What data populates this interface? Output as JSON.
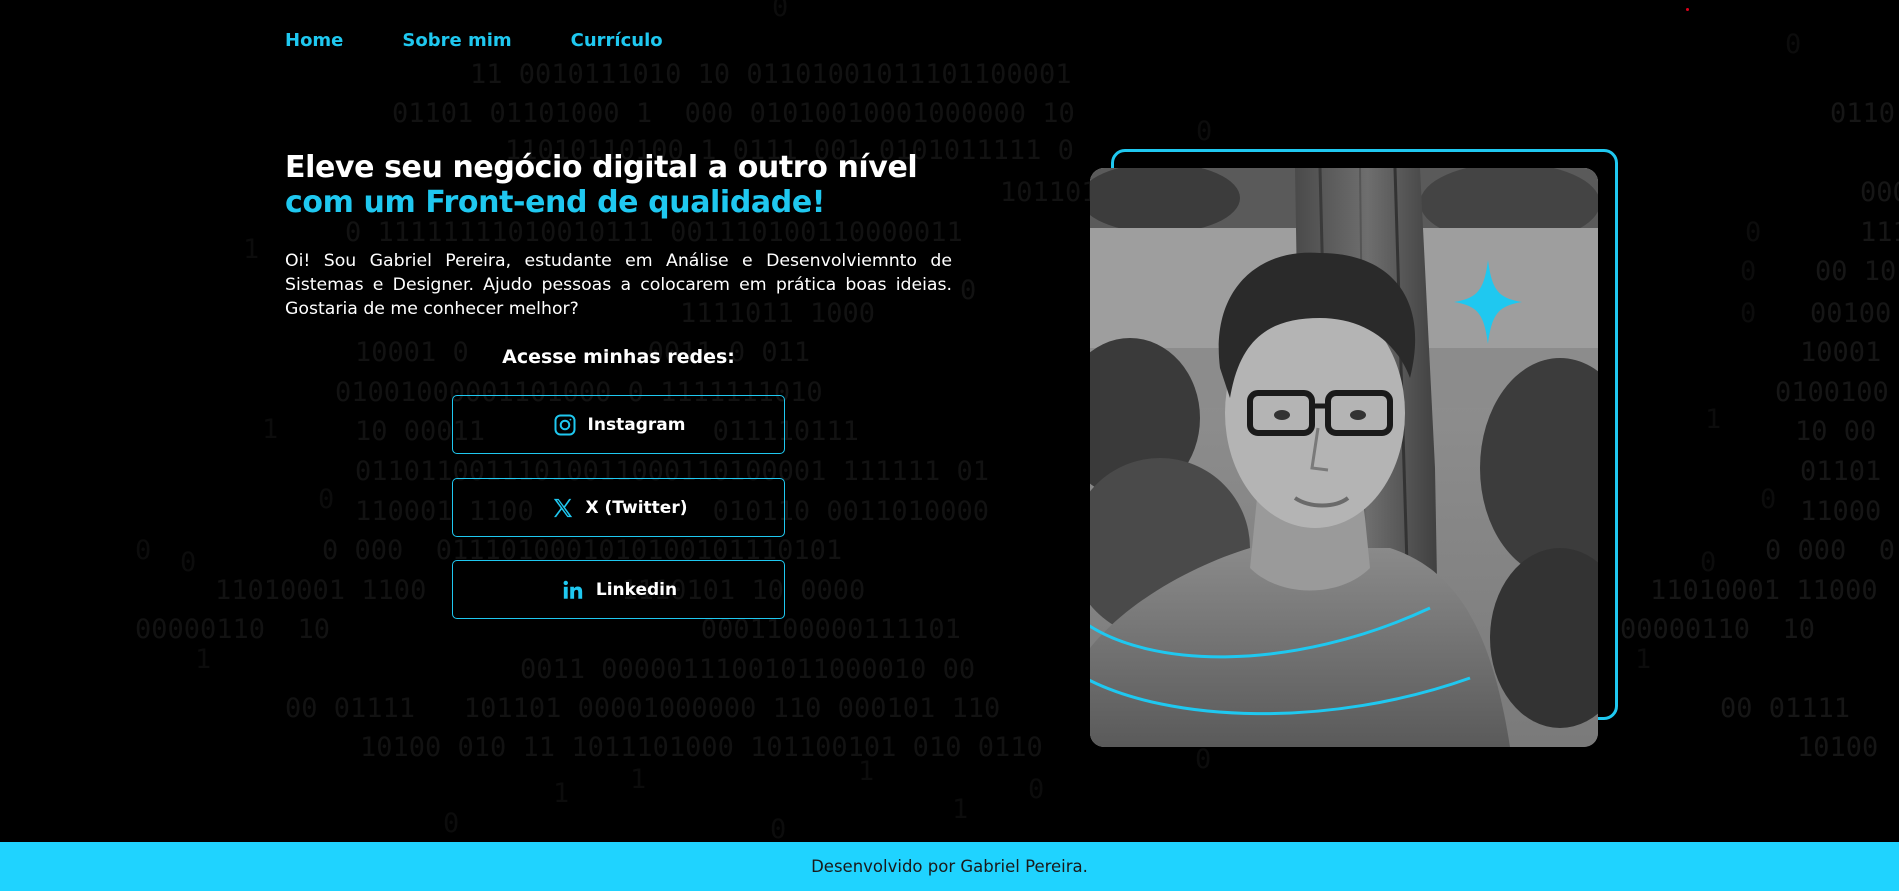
{
  "nav": {
    "items": [
      {
        "label": "Home"
      },
      {
        "label": "Sobre mim"
      },
      {
        "label": "Currículo"
      }
    ]
  },
  "hero": {
    "headline_line1": "Eleve seu negócio digital a outro nível",
    "headline_line2": "com um Front-end de qualidade!",
    "intro": "Oi! Sou Gabriel Pereira, estudante em Análise e Desenvolviemnto de Sistemas e Designer. Ajudo pessoas a colocarem em prática boas ideias. Gostaria de me conhecer melhor?"
  },
  "socials": {
    "title": "Acesse minhas redes:",
    "buttons": [
      {
        "label": "Instagram",
        "icon": "instagram-icon"
      },
      {
        "label": "X (Twitter)",
        "icon": "x-twitter-icon"
      },
      {
        "label": "Linkedin",
        "icon": "linkedin-icon"
      }
    ]
  },
  "footer": {
    "text": "Desenvolvido por Gabriel Pereira."
  },
  "colors": {
    "accent": "#1fc8f0",
    "footer_bg": "#1fd3ff",
    "background": "#000000"
  }
}
